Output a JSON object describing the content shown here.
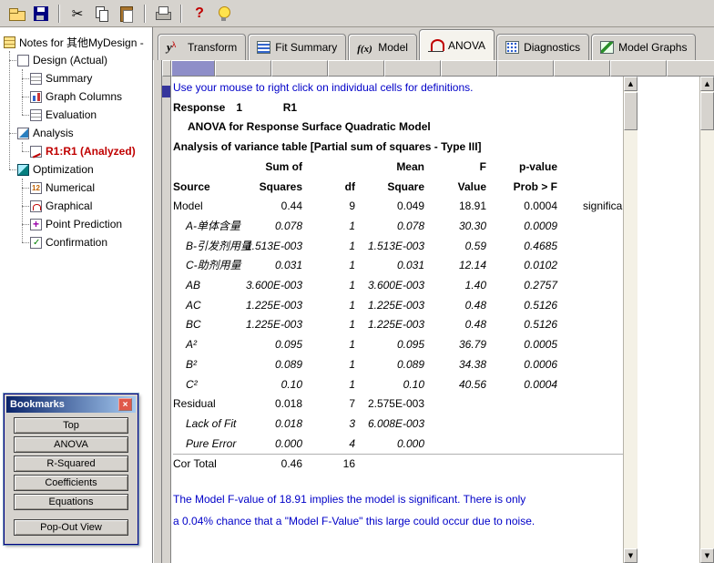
{
  "colors": {
    "hint_blue": "#0000c8",
    "analyzed_red": "#c00000",
    "selected_column": "#8e8ec8",
    "title_bar_blue": "#0a246a"
  },
  "toolbar": {
    "items": [
      "open-icon",
      "save-icon",
      "separator",
      "cut-icon",
      "copy-icon",
      "paste-icon",
      "separator",
      "print-icon",
      "separator",
      "help-icon",
      "tips-icon"
    ]
  },
  "tabs": {
    "items": [
      {
        "label": "Transform",
        "icon": "transform-icon",
        "active": false
      },
      {
        "label": "Fit Summary",
        "icon": "fit-summary-icon",
        "active": false
      },
      {
        "label": "Model",
        "icon": "model-icon",
        "active": false
      },
      {
        "label": "ANOVA",
        "icon": "anova-icon",
        "active": true
      },
      {
        "label": "Diagnostics",
        "icon": "diagnostics-icon",
        "active": false
      },
      {
        "label": "Model Graphs",
        "icon": "model-graphs-icon",
        "active": false
      }
    ]
  },
  "tree": {
    "items": [
      {
        "label": "Notes for 其他MyDesign -",
        "icon": "notes-icon",
        "level": 0
      },
      {
        "label": "Design (Actual)",
        "icon": "design-icon",
        "level": 1
      },
      {
        "label": "Summary",
        "icon": "summary-icon",
        "level": 2
      },
      {
        "label": "Graph Columns",
        "icon": "graph-columns-icon",
        "level": 2
      },
      {
        "label": "Evaluation",
        "icon": "evaluation-icon",
        "level": 2
      },
      {
        "label": "Analysis",
        "icon": "analysis-icon",
        "level": 1
      },
      {
        "label": "R1:R1 (Analyzed)",
        "icon": "r1-icon",
        "level": 2,
        "highlight": "analyzed"
      },
      {
        "label": "Optimization",
        "icon": "optimization-icon",
        "level": 1
      },
      {
        "label": "Numerical",
        "icon": "numerical-icon",
        "level": 2
      },
      {
        "label": "Graphical",
        "icon": "graphical-icon",
        "level": 2
      },
      {
        "label": "Point Prediction",
        "icon": "point-prediction-icon",
        "level": 2
      },
      {
        "label": "Confirmation",
        "icon": "confirmation-icon",
        "level": 2
      }
    ]
  },
  "bookmarks": {
    "title": "Bookmarks",
    "buttons": [
      "Top",
      "ANOVA",
      "R-Squared",
      "Coefficients",
      "Equations",
      "Pop-Out View"
    ]
  },
  "anova": {
    "hint": "Use your mouse to right click on individual cells for definitions.",
    "response_label": "Response",
    "response_number": "1",
    "response_name": "R1",
    "model_title": "ANOVA for Response Surface Quadratic Model",
    "table_title": "Analysis of variance table [Partial sum of squares - Type III]",
    "header_row1": {
      "ss": "Sum of",
      "ms": "Mean",
      "f": "F",
      "p": "p-value"
    },
    "header_row2": {
      "source": "Source",
      "ss": "Squares",
      "df": "df",
      "ms": "Square",
      "f": "Value",
      "p": "Prob > F"
    },
    "rows": [
      {
        "source": "Model",
        "ss": "0.44",
        "df": "9",
        "ms": "0.049",
        "f": "18.91",
        "p": "0.0004",
        "note": "significant"
      },
      {
        "source": "A-单体含量",
        "ss": "0.078",
        "df": "1",
        "ms": "0.078",
        "f": "30.30",
        "p": "0.0009",
        "em": true,
        "indent": 1
      },
      {
        "source": "B-引发剂用量",
        "ss": "1.513E-003",
        "df": "1",
        "ms": "1.513E-003",
        "f": "0.59",
        "p": "0.4685",
        "em": true,
        "indent": 1
      },
      {
        "source": "C-助剂用量",
        "ss": "0.031",
        "df": "1",
        "ms": "0.031",
        "f": "12.14",
        "p": "0.0102",
        "em": true,
        "indent": 1
      },
      {
        "source": "AB",
        "ss": "3.600E-003",
        "df": "1",
        "ms": "3.600E-003",
        "f": "1.40",
        "p": "0.2757",
        "em": true,
        "indent": 1
      },
      {
        "source": "AC",
        "ss": "1.225E-003",
        "df": "1",
        "ms": "1.225E-003",
        "f": "0.48",
        "p": "0.5126",
        "em": true,
        "indent": 1
      },
      {
        "source": "BC",
        "ss": "1.225E-003",
        "df": "1",
        "ms": "1.225E-003",
        "f": "0.48",
        "p": "0.5126",
        "em": true,
        "indent": 1
      },
      {
        "source": "A²",
        "ss": "0.095",
        "df": "1",
        "ms": "0.095",
        "f": "36.79",
        "p": "0.0005",
        "em": true,
        "indent": 1
      },
      {
        "source": "B²",
        "ss": "0.089",
        "df": "1",
        "ms": "0.089",
        "f": "34.38",
        "p": "0.0006",
        "em": true,
        "indent": 1
      },
      {
        "source": "C²",
        "ss": "0.10",
        "df": "1",
        "ms": "0.10",
        "f": "40.56",
        "p": "0.0004",
        "em": true,
        "indent": 1
      },
      {
        "source": "Residual",
        "ss": "0.018",
        "df": "7",
        "ms": "2.575E-003"
      },
      {
        "source": "Lack of Fit",
        "ss": "0.018",
        "df": "3",
        "ms": "6.008E-003",
        "em": true,
        "indent": 1
      },
      {
        "source": "Pure Error",
        "ss": "0.000",
        "df": "4",
        "ms": "0.000",
        "em": true,
        "indent": 1
      },
      {
        "source": "Cor Total",
        "ss": "0.46",
        "df": "16"
      }
    ],
    "footer_lines": [
      "The Model F-value of 18.91 implies the model is significant.  There is only",
      "a 0.04% chance that a \"Model F-Value\" this large could occur due to noise."
    ]
  }
}
